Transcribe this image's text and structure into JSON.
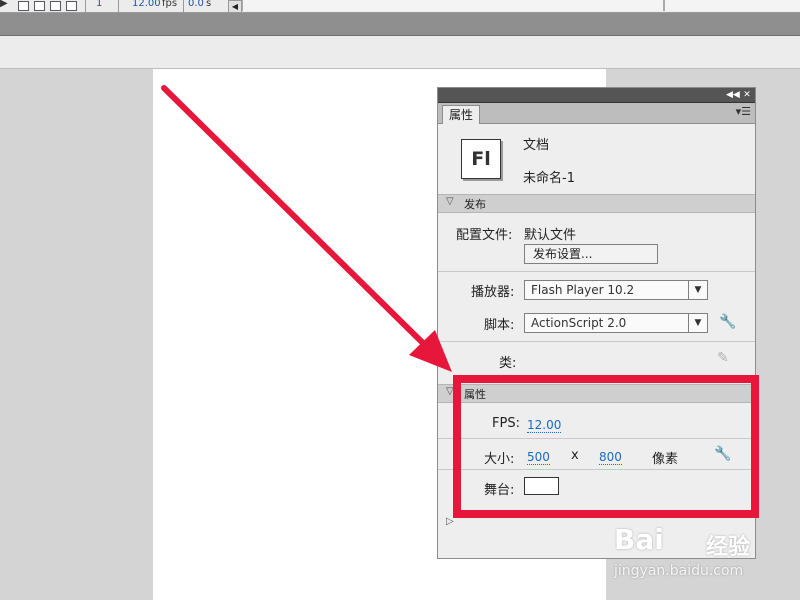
{
  "timeline": {
    "frame_number": "1",
    "fps_value": "12.00",
    "fps_unit": "fps",
    "time_value": "0.0",
    "time_unit": "s",
    "scroll_left": "◀"
  },
  "panel": {
    "collapse_icon": "◀◀",
    "close_icon": "✕",
    "tab_label": "属性",
    "tab_menu_icon": "▾☰",
    "doc_icon_text": "Fl",
    "doc_type": "文档",
    "doc_name": "未命名-1",
    "publish_section": {
      "title": "发布",
      "profile_label": "配置文件:",
      "profile_value": "默认文件",
      "settings_button": "发布设置..."
    },
    "player_label": "播放器:",
    "player_value": "Flash Player 10.2",
    "script_label": "脚本:",
    "script_value": "ActionScript 2.0",
    "class_label": "类:",
    "properties_section": {
      "title": "属性",
      "fps_label": "FPS:",
      "fps_value": "12.00",
      "size_label": "大小:",
      "width": "500",
      "times": "x",
      "height": "800",
      "unit": "像素",
      "stage_label": "舞台:"
    }
  },
  "icons": {
    "collapse": "double-left-arrow-icon",
    "close": "close-icon",
    "menu": "panel-menu-icon",
    "triangle": "disclosure-triangle-icon",
    "dropdown": "dropdown-arrow-icon",
    "wrench": "wrench-icon",
    "pencil": "pencil-icon"
  },
  "colors": {
    "annotation_red": "#e6173a",
    "link_blue": "#1b6bc2"
  },
  "watermark": {
    "brand": "Bai",
    "cn": "经验",
    "url": "jingyan.baidu.com"
  }
}
